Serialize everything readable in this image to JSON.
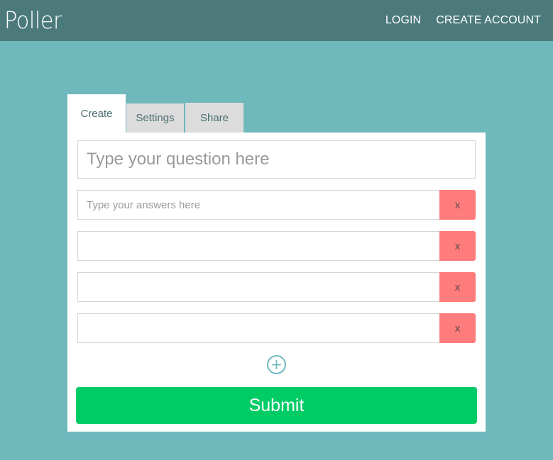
{
  "header": {
    "logo": "Poller",
    "nav": [
      {
        "label": "LOGIN"
      },
      {
        "label": "CREATE ACCOUNT"
      }
    ]
  },
  "tabs": [
    {
      "label": "Create",
      "active": true
    },
    {
      "label": "Settings",
      "active": false
    },
    {
      "label": "Share",
      "active": false
    }
  ],
  "form": {
    "question": {
      "value": "",
      "placeholder": "Type your question here"
    },
    "answers": [
      {
        "value": "",
        "placeholder": "Type your answers here",
        "remove_label": "x"
      },
      {
        "value": "",
        "placeholder": "",
        "remove_label": "x"
      },
      {
        "value": "",
        "placeholder": "",
        "remove_label": "x"
      },
      {
        "value": "",
        "placeholder": "",
        "remove_label": "x"
      }
    ],
    "add_icon": "plus-circle-icon",
    "submit_label": "Submit"
  },
  "colors": {
    "background": "#6fb8bc",
    "header": "#4c7a7b",
    "remove": "#ff7c7c",
    "submit": "#00cc66"
  }
}
